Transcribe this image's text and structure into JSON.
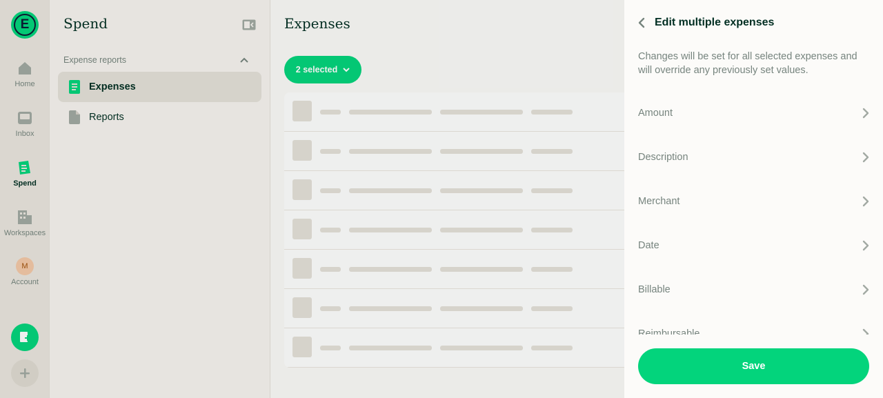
{
  "rail": {
    "items": [
      {
        "label": "Home",
        "icon": "home-icon"
      },
      {
        "label": "Inbox",
        "icon": "inbox-icon"
      },
      {
        "label": "Spend",
        "icon": "receipt-icon",
        "active": true
      },
      {
        "label": "Workspaces",
        "icon": "building-icon"
      },
      {
        "label": "Account",
        "icon": "avatar",
        "avatar_initial": "M"
      }
    ]
  },
  "sidebar": {
    "title": "Spend",
    "section_label": "Expense reports",
    "items": [
      {
        "label": "Expenses",
        "icon": "document-icon",
        "active": true
      },
      {
        "label": "Reports",
        "icon": "file-icon"
      }
    ]
  },
  "main": {
    "title": "Expenses",
    "selected_label": "2 selected",
    "skeleton_rows": 7
  },
  "panel": {
    "title": "Edit multiple expenses",
    "description": "Changes will be set for all selected expenses and will override any previously set values.",
    "fields": [
      {
        "label": "Amount"
      },
      {
        "label": "Description"
      },
      {
        "label": "Merchant"
      },
      {
        "label": "Date"
      },
      {
        "label": "Billable"
      },
      {
        "label": "Reimbursable"
      }
    ],
    "save_label": "Save"
  },
  "colors": {
    "accent": "#03d47c",
    "text_primary": "#002e22",
    "text_secondary": "#76847e",
    "sidebar_bg": "#f8f4f0",
    "panel_bg": "#fcfbf9"
  }
}
